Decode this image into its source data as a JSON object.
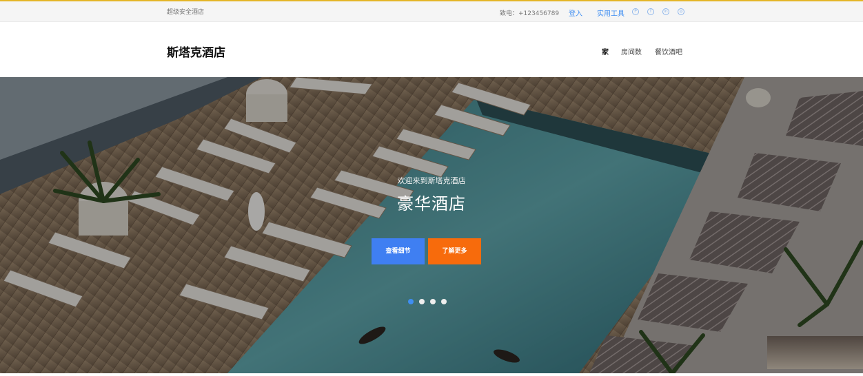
{
  "topbar": {
    "tagline": "超级安全酒店",
    "phone": "致电：+123456789",
    "login_label": "登入",
    "tools_label": "实用工具",
    "social_icons": [
      "pinterest-icon",
      "facebook-icon",
      "linkedin-icon",
      "dribbble-icon"
    ]
  },
  "header": {
    "brand": "斯塔克酒店",
    "nav": [
      {
        "label": "家",
        "active": true
      },
      {
        "label": "房间数",
        "active": false
      },
      {
        "label": "餐饮酒吧",
        "active": false
      }
    ]
  },
  "hero": {
    "welcome": "欢迎来到斯塔克酒店",
    "title": "豪华酒店",
    "primary_button": "查看细节",
    "secondary_button": "了解更多",
    "slide_count": 4,
    "active_slide": 1
  },
  "colors": {
    "accent_top": "#e4b528",
    "link_blue": "#3f8ef2",
    "button_blue": "#3f7ff2",
    "button_orange": "#f76b0c"
  }
}
